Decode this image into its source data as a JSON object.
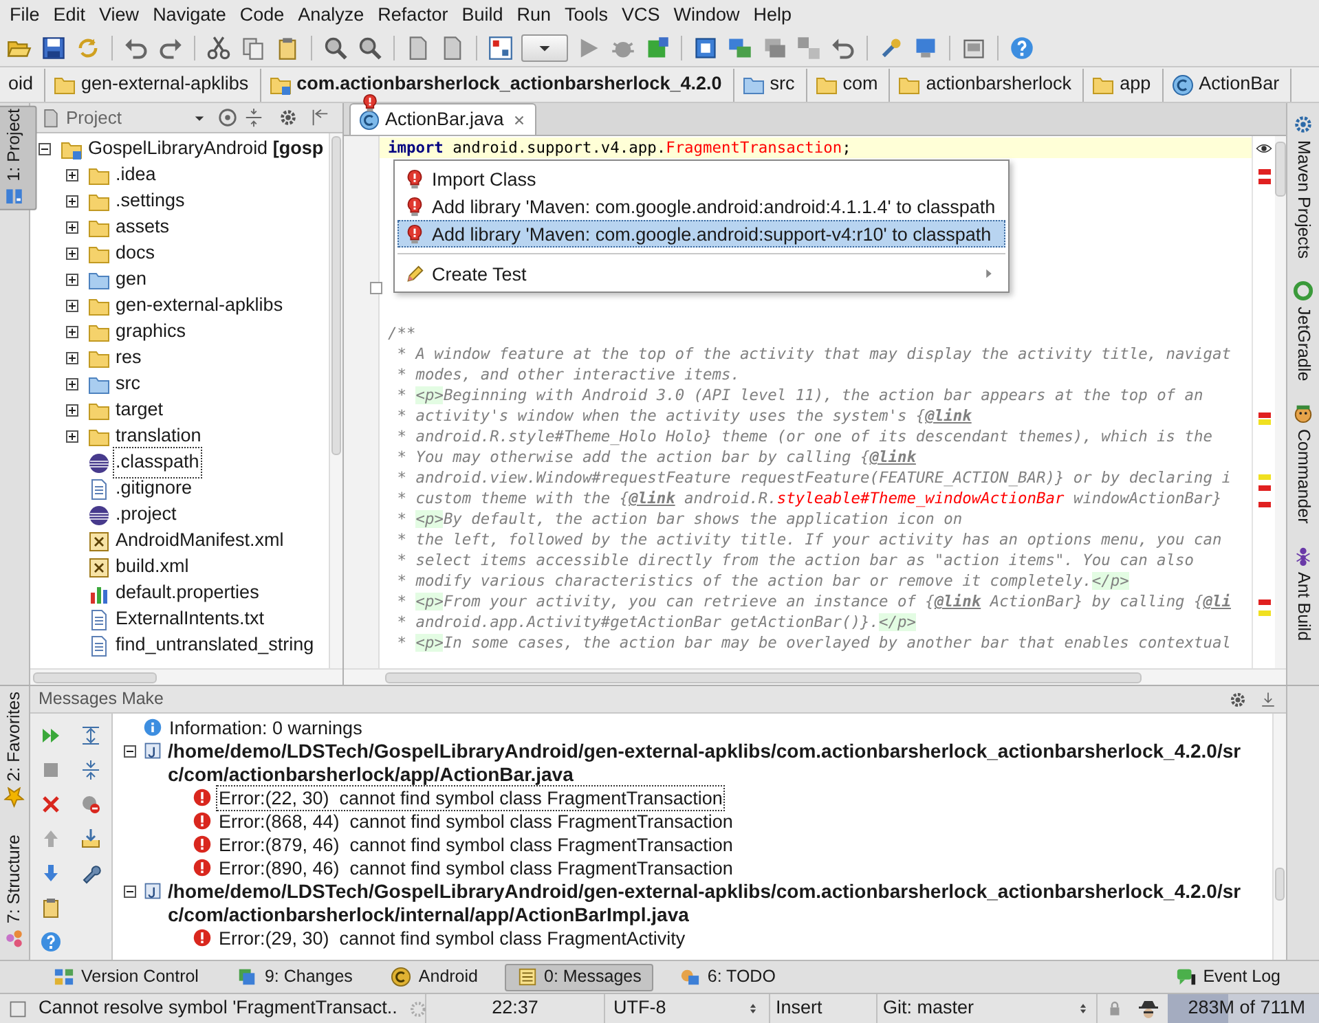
{
  "menu": [
    "File",
    "Edit",
    "View",
    "Navigate",
    "Code",
    "Analyze",
    "Refactor",
    "Build",
    "Run",
    "Tools",
    "VCS",
    "Window",
    "Help"
  ],
  "breadcrumbs": [
    {
      "label": "oid",
      "kind": "plain"
    },
    {
      "label": "gen-external-apklibs",
      "kind": "folder"
    },
    {
      "label": "com.actionbarsherlock_actionbarsherlock_4.2.0",
      "kind": "module"
    },
    {
      "label": "src",
      "kind": "source"
    },
    {
      "label": "com",
      "kind": "package"
    },
    {
      "label": "actionbarsherlock",
      "kind": "package"
    },
    {
      "label": "app",
      "kind": "package"
    },
    {
      "label": "ActionBar",
      "kind": "class"
    }
  ],
  "tool_windows": {
    "left_top": [
      {
        "label": "1: Project",
        "kind": "project",
        "selected": true
      }
    ],
    "left_bottom": [
      {
        "label": "2: Favorites",
        "kind": "favorites",
        "selected": false
      },
      {
        "label": "7: Structure",
        "kind": "structure",
        "selected": false
      }
    ],
    "right": [
      {
        "label": "Maven Projects",
        "kind": "maven",
        "selected": false
      },
      {
        "label": "JetGradle",
        "kind": "gradle",
        "selected": false
      },
      {
        "label": "Commander",
        "kind": "commander",
        "selected": false
      },
      {
        "label": "Ant Build",
        "kind": "ant",
        "selected": false
      }
    ]
  },
  "project_panel": {
    "view": "Project",
    "tree": [
      {
        "label": "GospelLibraryAndroid **[gosp**",
        "kind": "module",
        "expanded": true,
        "selected": false,
        "children": [
          {
            "label": ".idea",
            "kind": "folder",
            "expanded": false,
            "selected": false
          },
          {
            "label": ".settings",
            "kind": "folder",
            "expanded": false,
            "selected": false
          },
          {
            "label": "assets",
            "kind": "folder",
            "expanded": false,
            "selected": false
          },
          {
            "label": "docs",
            "kind": "folder",
            "expanded": false,
            "selected": false
          },
          {
            "label": "gen",
            "kind": "source",
            "expanded": false,
            "selected": false
          },
          {
            "label": "gen-external-apklibs",
            "kind": "folder",
            "expanded": false,
            "selected": false
          },
          {
            "label": "graphics",
            "kind": "folder",
            "expanded": false,
            "selected": false
          },
          {
            "label": "res",
            "kind": "folder",
            "expanded": false,
            "selected": false
          },
          {
            "label": "src",
            "kind": "source",
            "expanded": false,
            "selected": false
          },
          {
            "label": "target",
            "kind": "folder",
            "expanded": false,
            "selected": false
          },
          {
            "label": "translation",
            "kind": "folder",
            "expanded": false,
            "selected": false
          },
          {
            "label": ".classpath",
            "kind": "eclipse",
            "selected": true
          },
          {
            "label": ".gitignore",
            "kind": "text",
            "selected": false
          },
          {
            "label": ".project",
            "kind": "eclipse",
            "selected": false
          },
          {
            "label": "AndroidManifest.xml",
            "kind": "xml",
            "selected": false
          },
          {
            "label": "build.xml",
            "kind": "xml",
            "selected": false
          },
          {
            "label": "default.properties",
            "kind": "properties",
            "selected": false
          },
          {
            "label": "ExternalIntents.txt",
            "kind": "text",
            "selected": false
          },
          {
            "label": "find_untranslated_string",
            "kind": "text",
            "selected": false
          }
        ]
      }
    ]
  },
  "editor": {
    "tabs": [
      {
        "label": "ActionBar.java",
        "selected": true
      }
    ],
    "lines": [
      {
        "current": true,
        "segments": [
          {
            "kind": "keyword",
            "text": "import"
          },
          {
            "kind": "plain",
            "text": " android.support.v4.app."
          },
          {
            "kind": "unresolved",
            "text": "FragmentTransaction"
          },
          {
            "kind": "plain",
            "text": ";"
          }
        ]
      },
      {
        "current": false
      },
      {
        "current": false,
        "segments": [
          {
            "kind": "comment",
            "text": "/**"
          }
        ]
      },
      {
        "current": false,
        "segments": [
          {
            "kind": "comment",
            "text": " * A window feature at the top of the activity that may display the activity title, navigat"
          }
        ]
      },
      {
        "current": false,
        "segments": [
          {
            "kind": "comment",
            "text": " * modes, and other interactive items."
          }
        ]
      },
      {
        "current": false,
        "segments": [
          {
            "kind": "comment",
            "text": " * "
          },
          {
            "kind": "tag",
            "text": "<p>"
          },
          {
            "kind": "comment",
            "text": "Beginning with Android 3.0 (API level 11), the action bar appears at the top of an"
          }
        ]
      },
      {
        "current": false,
        "segments": [
          {
            "kind": "comment",
            "text": " * activity's window when the activity uses the system's {"
          },
          {
            "kind": "link",
            "text": "@link"
          }
        ]
      },
      {
        "current": false,
        "segments": [
          {
            "kind": "comment",
            "text": " * android.R.style#Theme_Holo Holo} theme (or one of its descendant themes), which is the"
          }
        ]
      },
      {
        "current": false,
        "segments": [
          {
            "kind": "comment",
            "text": " * You may otherwise add the action bar by calling {"
          },
          {
            "kind": "link",
            "text": "@link"
          }
        ]
      },
      {
        "current": false,
        "segments": [
          {
            "kind": "comment",
            "text": " * android.view.Window#requestFeature requestFeature(FEATURE_ACTION_BAR)} or by declaring i"
          }
        ]
      },
      {
        "current": false,
        "segments": [
          {
            "kind": "comment",
            "text": " * custom theme with the {"
          },
          {
            "kind": "link",
            "text": "@link"
          },
          {
            "kind": "comment",
            "text": " android.R."
          },
          {
            "kind": "unresolved",
            "text": "styleable#Theme_windowActionBar"
          },
          {
            "kind": "comment",
            "text": " windowActionBar}"
          }
        ]
      },
      {
        "current": false,
        "segments": [
          {
            "kind": "comment",
            "text": " * "
          },
          {
            "kind": "tag",
            "text": "<p>"
          },
          {
            "kind": "comment",
            "text": "By default, the action bar shows the application icon on"
          }
        ]
      },
      {
        "current": false,
        "segments": [
          {
            "kind": "comment",
            "text": " * the left, followed by the activity title. If your activity has an options menu, you can"
          }
        ]
      },
      {
        "current": false,
        "segments": [
          {
            "kind": "comment",
            "text": " * select items accessible directly from the action bar as \"action items\". You can also"
          }
        ]
      },
      {
        "current": false,
        "segments": [
          {
            "kind": "comment",
            "text": " * modify various characteristics of the action bar or remove it completely."
          },
          {
            "kind": "tag",
            "text": "</p>"
          }
        ]
      },
      {
        "current": false,
        "segments": [
          {
            "kind": "comment",
            "text": " * "
          },
          {
            "kind": "tag",
            "text": "<p>"
          },
          {
            "kind": "comment",
            "text": "From your activity, you can retrieve an instance of {"
          },
          {
            "kind": "link",
            "text": "@link"
          },
          {
            "kind": "comment",
            "text": " ActionBar} by calling {"
          },
          {
            "kind": "link",
            "text": "@li"
          }
        ]
      },
      {
        "current": false,
        "segments": [
          {
            "kind": "comment",
            "text": " * android.app.Activity#getActionBar getActionBar()}."
          },
          {
            "kind": "tag",
            "text": "</p>"
          }
        ]
      },
      {
        "current": false,
        "segments": [
          {
            "kind": "comment",
            "text": " * "
          },
          {
            "kind": "tag",
            "text": "<p>"
          },
          {
            "kind": "comment",
            "text": "In some cases, the action bar may be overlayed by another bar that enables contextual"
          }
        ]
      }
    ],
    "popup": [
      {
        "label": "Import Class",
        "kind": "quickfix",
        "selected": false
      },
      {
        "label": "Add library 'Maven: com.google.android:android:4.1.1.4' to classpath",
        "kind": "quickfix",
        "selected": false
      },
      {
        "label": "Add library 'Maven: com.google.android:support-v4:r10' to classpath",
        "kind": "quickfix",
        "selected": true
      },
      {
        "label": "Create Test",
        "kind": "submenu",
        "selected": false
      }
    ]
  },
  "messages": {
    "title": "Messages Make",
    "tree": [
      {
        "kind": "info",
        "label": "Information: 0 warnings",
        "selected": false
      },
      {
        "kind": "file",
        "label": "/home/demo/LDSTech/GospelLibraryAndroid/gen-external-apklibs/com.actionbarsherlock_actionbarsherlock_4.2.0/src/com/actionbarsherlock/app/ActionBar.java",
        "expanded": true,
        "selected": false,
        "children": [
          {
            "kind": "error",
            "label": "Error:(22, 30)  cannot find symbol class FragmentTransaction",
            "selected": true
          },
          {
            "kind": "error",
            "label": "Error:(868, 44)  cannot find symbol class FragmentTransaction",
            "selected": false
          },
          {
            "kind": "error",
            "label": "Error:(879, 46)  cannot find symbol class FragmentTransaction",
            "selected": false
          },
          {
            "kind": "error",
            "label": "Error:(890, 46)  cannot find symbol class FragmentTransaction",
            "selected": false
          }
        ]
      },
      {
        "kind": "file",
        "label": "/home/demo/LDSTech/GospelLibraryAndroid/gen-external-apklibs/com.actionbarsherlock_actionbarsherlock_4.2.0/src/com/actionbarsherlock/internal/app/ActionBarImpl.java",
        "expanded": true,
        "selected": false,
        "children": [
          {
            "kind": "error",
            "label": "Error:(29, 30)  cannot find symbol class FragmentActivity",
            "selected": false
          }
        ]
      }
    ]
  },
  "bottom_tabs": [
    {
      "label": "Version Control",
      "kind": "vcs",
      "selected": false
    },
    {
      "label": "9: Changes",
      "kind": "changes",
      "selected": false
    },
    {
      "label": "Android",
      "kind": "android",
      "selected": false
    },
    {
      "label": "0: Messages",
      "kind": "messages",
      "selected": true
    },
    {
      "label": "6: TODO",
      "kind": "todo",
      "selected": false
    }
  ],
  "event_log": "Event Log",
  "status_bar": {
    "message": "Cannot resolve symbol 'FragmentTransact..",
    "position": "22:37",
    "encoding": "UTF-8",
    "insert_mode": "Insert",
    "branch": "Git: master",
    "memory": {
      "text": "283M of 711M",
      "level": 0.4
    }
  }
}
